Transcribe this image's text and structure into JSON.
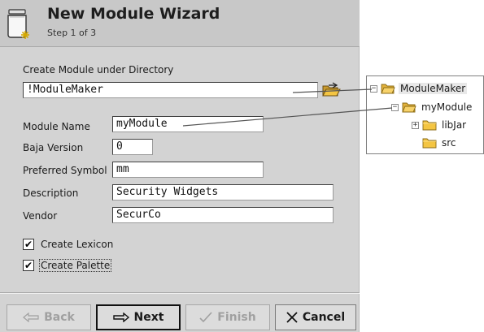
{
  "wizard": {
    "title": "New Module Wizard",
    "step": "Step 1 of 3"
  },
  "form": {
    "directory_label": "Create Module under Directory",
    "directory_value": "!ModuleMaker",
    "module_name_label": "Module Name",
    "module_name_value": "myModule",
    "baja_version_label": "Baja Version",
    "baja_version_value": "0",
    "preferred_symbol_label": "Preferred Symbol",
    "preferred_symbol_value": "mm",
    "description_label": "Description",
    "description_value": "Security Widgets",
    "vendor_label": "Vendor",
    "vendor_value": "SecurCo",
    "create_lexicon_label": "Create Lexicon",
    "create_lexicon_checked": true,
    "create_palette_label": "Create Palette",
    "create_palette_checked": true
  },
  "buttons": {
    "back": "Back",
    "next": "Next",
    "finish": "Finish",
    "cancel": "Cancel"
  },
  "tree": {
    "nodes": [
      {
        "label": "ModuleMaker",
        "expander": "minus",
        "icon": "folder-open-icon"
      },
      {
        "label": "myModule",
        "expander": "minus",
        "icon": "folder-open-icon"
      },
      {
        "label": "libJar",
        "expander": "plus",
        "icon": "folder-icon"
      },
      {
        "label": "src",
        "expander": "none",
        "icon": "folder-icon"
      }
    ]
  },
  "colors": {
    "dialog_bg": "#d3d3d3",
    "folder_yellow": "#f4c542",
    "disabled_text": "#a0a0a0"
  }
}
